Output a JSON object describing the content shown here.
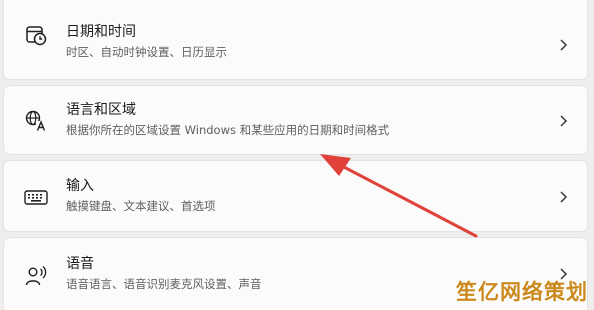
{
  "settings": {
    "items": [
      {
        "icon": "clock-calendar-icon",
        "title": "日期和时间",
        "subtitle": "时区、自动时钟设置、日历显示"
      },
      {
        "icon": "language-icon",
        "title": "语言和区域",
        "subtitle": "根据你所在的区域设置 Windows 和某些应用的日期和时间格式"
      },
      {
        "icon": "keyboard-icon",
        "title": "输入",
        "subtitle": "触摸键盘、文本建议、首选项"
      },
      {
        "icon": "speech-icon",
        "title": "语音",
        "subtitle": "语音语言、语音识别麦克风设置、声音"
      }
    ]
  },
  "watermark": {
    "text": "笙亿网络策划"
  },
  "colors": {
    "annotation_arrow": "#e0423a",
    "watermark": "#cc8a1e"
  }
}
